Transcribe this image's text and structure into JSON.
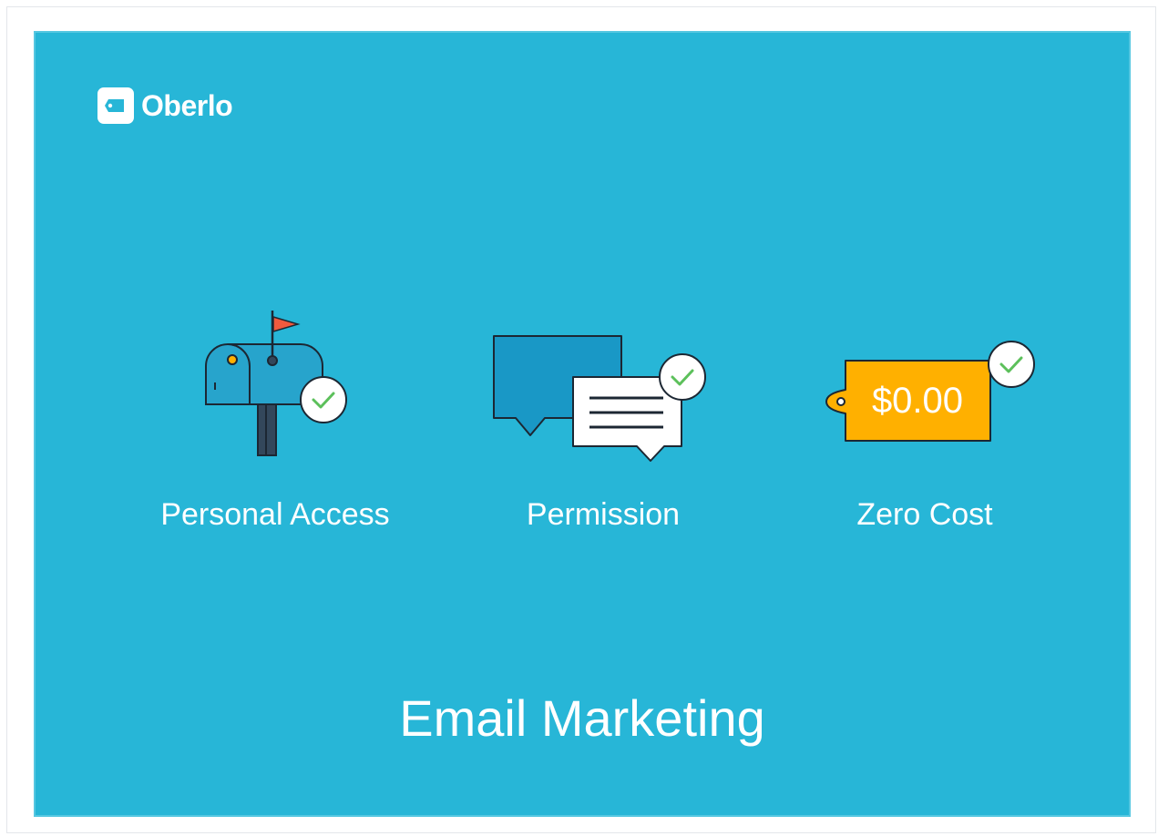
{
  "brand": {
    "name": "Oberlo",
    "mark_icon": "tag-icon"
  },
  "features": [
    {
      "label": "Personal Access",
      "icon": "mailbox-icon",
      "badge": "check-icon"
    },
    {
      "label": "Permission",
      "icon": "chat-bubbles-icon",
      "badge": "check-icon"
    },
    {
      "label": "Zero Cost",
      "icon": "price-tag-icon",
      "price_text": "$0.00",
      "badge": "check-icon"
    }
  ],
  "title": "Email Marketing",
  "colors": {
    "background": "#27b6d7",
    "text": "#ffffff",
    "flag": "#f05a3e",
    "price_tag": "#ffb000",
    "check": "#5cc05b"
  }
}
